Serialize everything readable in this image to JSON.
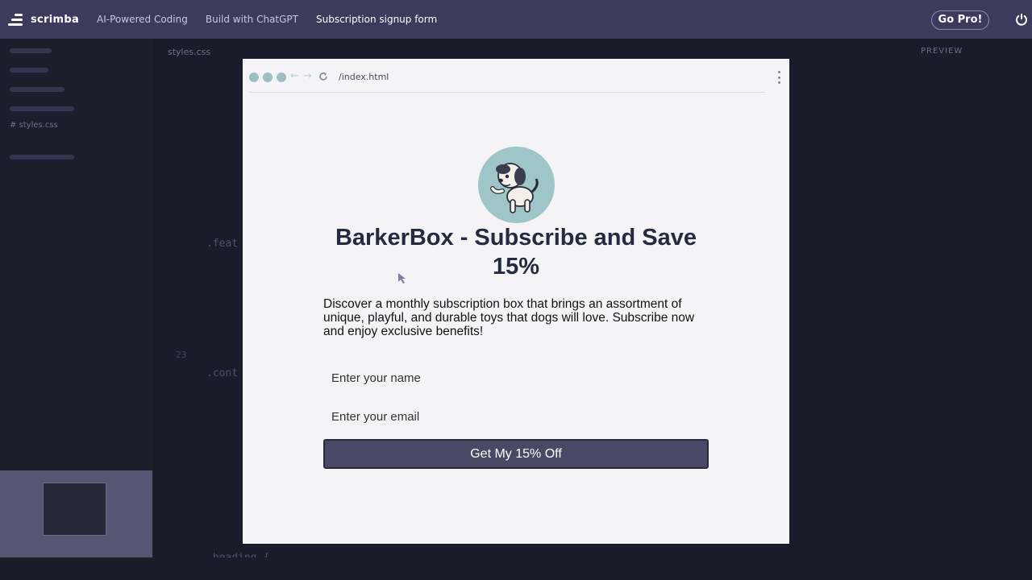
{
  "app": {
    "brand": "scrimba",
    "breadcrumbs": [
      "AI-Powered Coding",
      "Build with ChatGPT",
      "Subscription signup form"
    ],
    "go_pro_label": "Go Pro!",
    "power_icon": "power-icon"
  },
  "editor": {
    "tab_label": "styles.css",
    "sidebar_file": "# styles.css",
    "preview_tab_label": "PREVIEW",
    "line_number": "23",
    "visible_code": [
      ".feat",
      ".cont",
      ".heading {"
    ]
  },
  "preview": {
    "url": "/index.html",
    "title": "BarkerBox - Subscribe and Save 15%",
    "description": "Discover a monthly subscription box that brings an assortment of unique, playful, and durable toys that dogs will love. Subscribe now and enjoy exclusive benefits!",
    "name_placeholder": "Enter your name",
    "email_placeholder": "Enter your email",
    "cta_label": "Get My 15% Off",
    "image_bg_color": "#9ec6c9"
  },
  "colors": {
    "topbar": "#3d3a5c",
    "cta": "#4a4864",
    "editor_bg": "#1b1c2a"
  }
}
